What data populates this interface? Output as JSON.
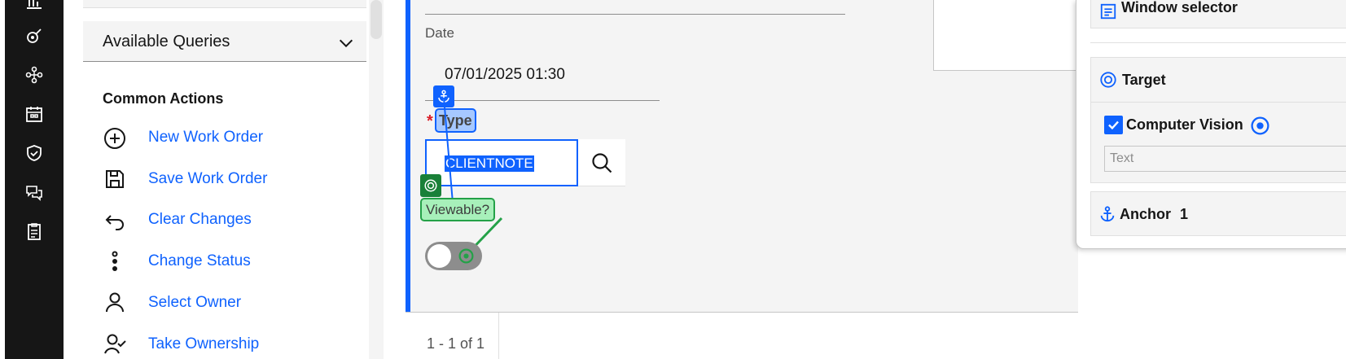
{
  "left_panel": {
    "queries_label": "Available Queries",
    "common_actions_title": "Common Actions",
    "actions": [
      {
        "label": "New Work Order",
        "icon": "add-circle-icon"
      },
      {
        "label": "Save Work Order",
        "icon": "save-icon"
      },
      {
        "label": "Clear Changes",
        "icon": "undo-icon"
      },
      {
        "label": "Change Status",
        "icon": "overflow-vertical-icon"
      },
      {
        "label": "Select Owner",
        "icon": "user-icon"
      },
      {
        "label": "Take Ownership",
        "icon": "user-check-icon"
      }
    ]
  },
  "form": {
    "date_label": "Date",
    "date_value": "07/01/2025 01:30",
    "type_required_mark": "*",
    "type_label": "Type",
    "type_value": "CLIENTNOTE",
    "viewable_label": "Viewable?",
    "viewable_on": false
  },
  "pagination": {
    "text": "1 - 1 of 1"
  },
  "vision_panel": {
    "window_selector_label": "Window selector",
    "target_label": "Target",
    "computer_vision_label": "Computer Vision",
    "computer_vision_checked": true,
    "text_select_value": "Text",
    "anchor_label": "Anchor",
    "anchor_count": "1"
  },
  "colors": {
    "accent": "#0f62fe",
    "target_green": "#24a148",
    "rail_bg": "#161616",
    "form_bg": "#f4f4f4"
  }
}
